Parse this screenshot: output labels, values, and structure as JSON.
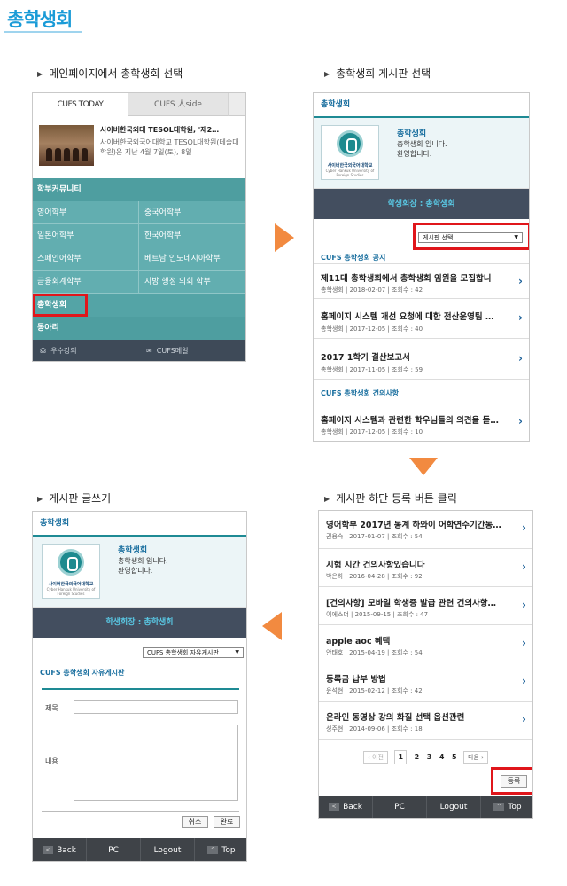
{
  "page_title": "총학생회",
  "steps": {
    "s1": "메인페이지에서 총학생회 선택",
    "s2": "총학생회 게시판 선택",
    "s3": "게시판 글쓰기",
    "s4": "게시판 하단 등록 버튼 클릭"
  },
  "colors": {
    "accent": "#1a9bd7",
    "teal": "#62aeb0",
    "highlight": "#e0161b",
    "arrow": "#f28a40"
  },
  "main_page": {
    "tabs": [
      "CUFS TODAY",
      "CUFS 人side"
    ],
    "news_title": "사이버한국외대 TESOL대학원, '제2…",
    "news_body": "사이버한국외국어대학교 TESOL대학원(테솔대학원)은 지난 4월 7일(토), 8일",
    "group_title": "학부커뮤니티",
    "majors": [
      "영어학부",
      "중국어학부",
      "일본어학부",
      "한국어학부",
      "스페인어학부",
      "베트남 인도네시아학부",
      "금융회계학부",
      "지방 행정 의회 학부"
    ],
    "student_council": "총학생회",
    "club": "동아리",
    "bottom": [
      "우수강의",
      "CUFS메일"
    ]
  },
  "board": {
    "header": "총학생회",
    "profile_name": "총학생회",
    "profile_desc1": "총학생회 입니다.",
    "profile_desc2": "환영합니다.",
    "logo_name": "사이버한국외국어대학교",
    "logo_sub": "Cyber Hankuk University of Foreign Studies",
    "president": "학생회장 : 총학생회",
    "select_placeholder": "게시판 선택",
    "notice_section": "CUFS 총학생회 공지",
    "suggest_section": "CUFS 총학생회 건의사항",
    "posts": [
      {
        "title": "제11대 총학생회에서 총학생회 임원을 모집합니",
        "meta": "총학생회 | 2018-02-07 | 조회수 : 42"
      },
      {
        "title": "홈페이지 시스템 개선 요청에 대한 전산운영팀 …",
        "meta": "총학생회 | 2017-12-05 | 조회수 : 40"
      },
      {
        "title": "2017 1학기 결산보고서",
        "meta": "총학생회 | 2017-11-05 | 조회수 : 59"
      }
    ],
    "suggest_posts": [
      {
        "title": "홈페이지 시스템과 관련한 학우님들의 의견을 듣…",
        "meta": "총학생회 | 2017-12-05 | 조회수 : 10"
      }
    ]
  },
  "list_page": {
    "posts": [
      {
        "title": "영어학부 2017년 동계 하와이 어학연수기간동…",
        "meta": "권용숙 | 2017-01-07 | 조회수 : 54"
      },
      {
        "title": "시험 시간 건의사항있습니다",
        "meta": "박은하 | 2016-04-28 | 조회수 : 92"
      },
      {
        "title": "[건의사항] 모바일 학생증 발급 관련 건의사항…",
        "meta": "이에스더 | 2015-09-15 | 조회수 : 47"
      },
      {
        "title": "apple aoc 혜택",
        "meta": "안태호 | 2015-04-19 | 조회수 : 54"
      },
      {
        "title": "등록금 납부 방법",
        "meta": "윤석현 | 2015-02-12 | 조회수 : 42"
      },
      {
        "title": "온라인 동영상 강의 화질 선택 옵션관련",
        "meta": "성주현 | 2014-09-06 | 조회수 : 18"
      }
    ],
    "prev": "‹ 이전",
    "pages": [
      "1",
      "2",
      "3",
      "4",
      "5"
    ],
    "next": "다음 ›",
    "register": "등록"
  },
  "write_page": {
    "select_value": "CUFS 총학생회 자유게시판",
    "form_title": "CUFS 총학생회 자유게시판",
    "label_title": "제목",
    "label_content": "내용",
    "cancel": "취소",
    "done": "완료"
  },
  "bottom_nav": {
    "back": "Back",
    "pc": "PC",
    "logout": "Logout",
    "top": "Top"
  }
}
